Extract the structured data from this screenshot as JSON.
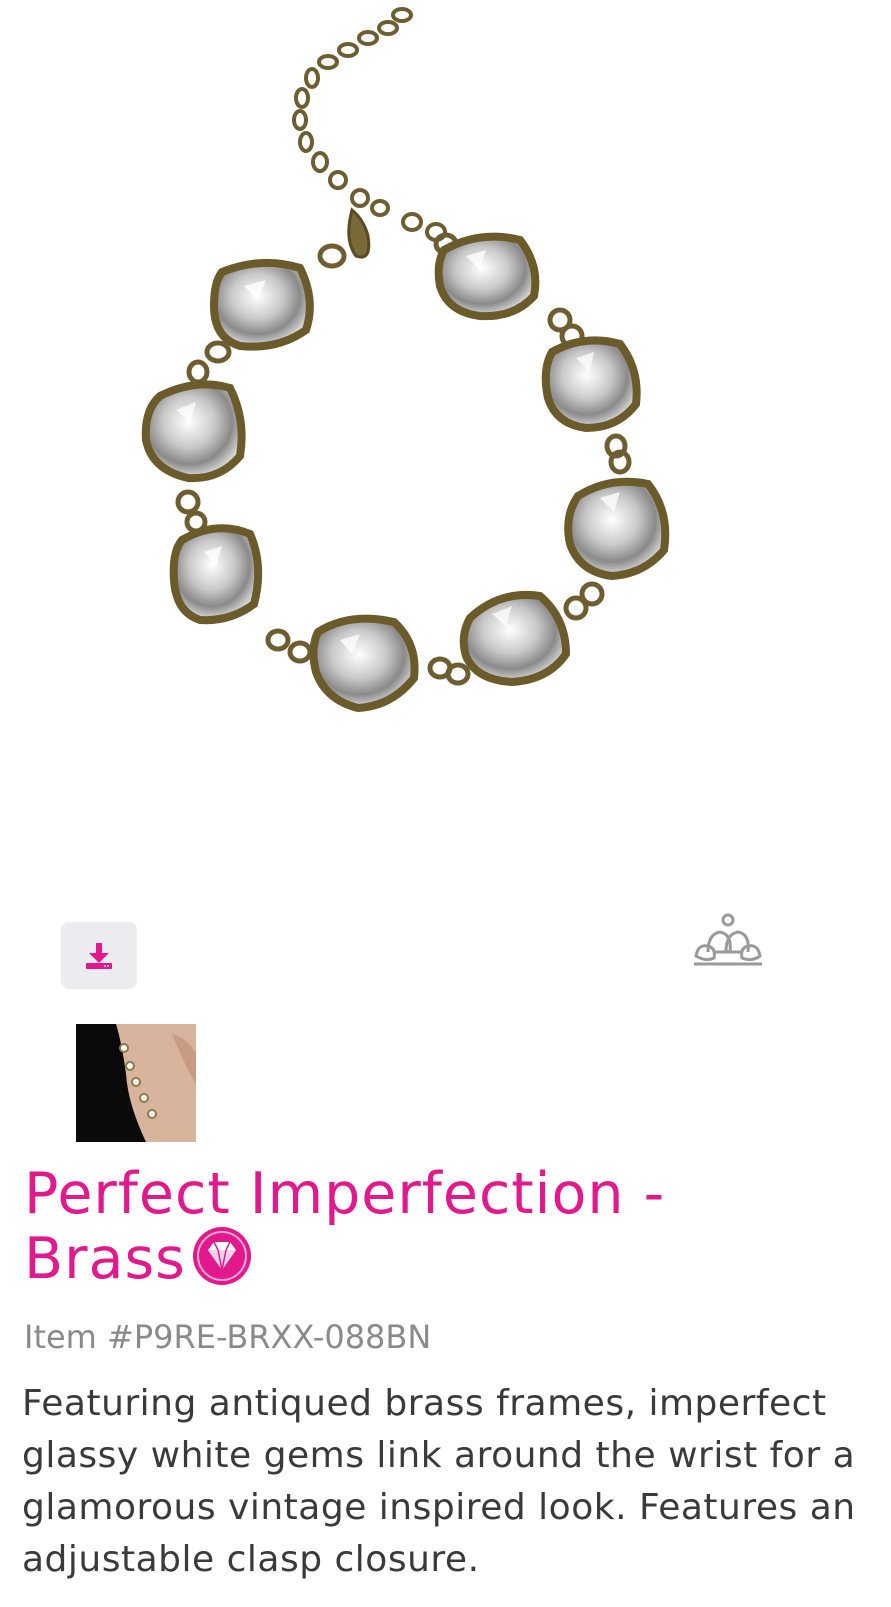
{
  "product": {
    "title": "Perfect Imperfection - Brass",
    "item_number": "Item #P9RE-BRXX-088BN",
    "description": "Featuring antiqued brass frames, imperfect glassy white gems link around the wrist for a glamorous vintage inspired look. Features an adjustable clasp closure."
  },
  "icons": {
    "download": "download-icon",
    "brand": "paparazzi-crown-logo",
    "badge": "diamond-badge-icon"
  },
  "colors": {
    "accent": "#e2198c",
    "brass": "#7a6a3a",
    "download_bg": "#ebebf0",
    "text": "#3a3a3a",
    "muted": "#8a8a8a"
  }
}
